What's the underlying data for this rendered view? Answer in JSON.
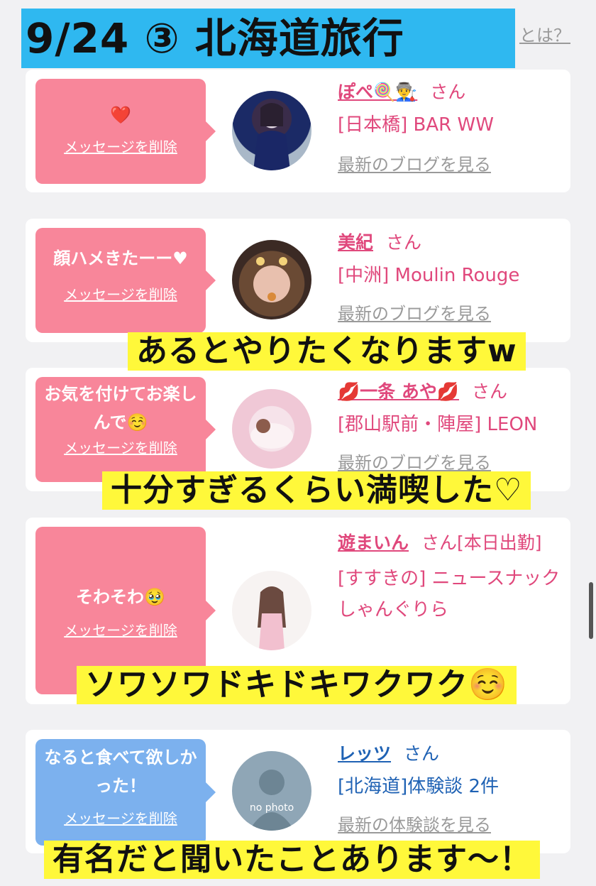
{
  "title": "9/24 ③ 北海道旅行",
  "top_link": "とは？",
  "delete_label": "メッセージを削除",
  "san": "さん",
  "cards": [
    {
      "message": "❤️",
      "name": "ぽぺ🍭👨‍🏭",
      "san": "さん",
      "shop": "[日本橋] BAR WW",
      "link": "最新のブログを見る"
    },
    {
      "message": "顔ハメきたーー♥",
      "name": "美紀",
      "san": "さん",
      "shop": "[中洲] Moulin Rouge",
      "link": "最新のブログを見る"
    },
    {
      "message": "お気を付けてお楽しんで☺️",
      "name": "💋一条 あや💋",
      "san": "さん",
      "shop": "[郡山駅前・陣屋] LEON",
      "link": "最新のブログを見る"
    },
    {
      "message": "そわそわ🥹",
      "name": "遊まいん",
      "san": "さん[本日出勤]",
      "shop": "[すすきの] ニュースナックしゃんぐりら",
      "link": ""
    },
    {
      "message": "なると食べて欲しかった！",
      "name": "レッツ",
      "san": "さん",
      "shop": "[北海道]体験談 2件",
      "link": "最新の体験談を見る",
      "avatar_text": "no photo"
    }
  ],
  "captions": [
    "あるとやりたくなりますw",
    "十分すぎるくらい満喫した♡",
    "ソワソワドキドキワクワク☺️",
    "有名だと聞いたことあります〜！"
  ],
  "colors": {
    "pink_bubble": "#f8869a",
    "blue_bubble": "#7cb1ee",
    "pink_text": "#e0487c",
    "blue_text": "#1f62b4",
    "caption_bg": "#fff83a",
    "title_bg": "#2fb8f0"
  }
}
